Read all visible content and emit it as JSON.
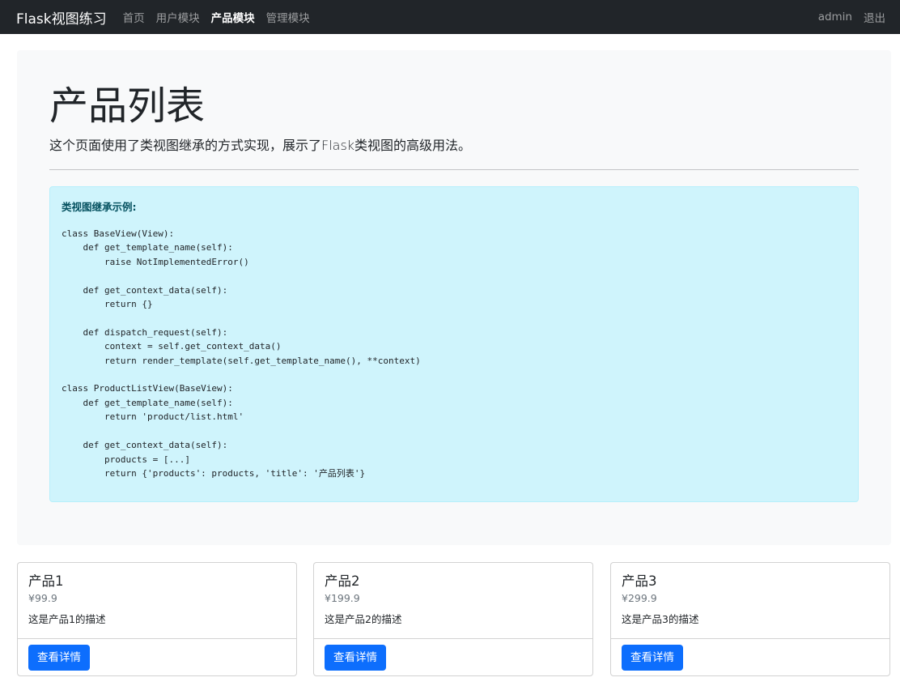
{
  "navbar": {
    "brand": "Flask视图练习",
    "links": [
      {
        "label": "首页",
        "active": false
      },
      {
        "label": "用户模块",
        "active": false
      },
      {
        "label": "产品模块",
        "active": true
      },
      {
        "label": "管理模块",
        "active": false
      }
    ],
    "user": "admin",
    "logout": "退出"
  },
  "jumbotron": {
    "title": "产品列表",
    "lead": "这个页面使用了类视图继承的方式实现，展示了Flask类视图的高级用法。",
    "alert_title": "类视图继承示例:",
    "code": "class BaseView(View):\n    def get_template_name(self):\n        raise NotImplementedError()\n\n    def get_context_data(self):\n        return {}\n\n    def dispatch_request(self):\n        context = self.get_context_data()\n        return render_template(self.get_template_name(), **context)\n\nclass ProductListView(BaseView):\n    def get_template_name(self):\n        return 'product/list.html'\n\n    def get_context_data(self):\n        products = [...]\n        return {'products': products, 'title': '产品列表'}"
  },
  "products": [
    {
      "name": "产品1",
      "price": "¥99.9",
      "description": "这是产品1的描述",
      "button": "查看详情"
    },
    {
      "name": "产品2",
      "price": "¥199.9",
      "description": "这是产品2的描述",
      "button": "查看详情"
    },
    {
      "name": "产品3",
      "price": "¥299.9",
      "description": "这是产品3的描述",
      "button": "查看详情"
    }
  ],
  "colors": {
    "navbar_bg": "#212529",
    "jumbotron_bg": "#f8f9fa",
    "alert_bg": "#cff4fc",
    "primary": "#0d6efd"
  }
}
